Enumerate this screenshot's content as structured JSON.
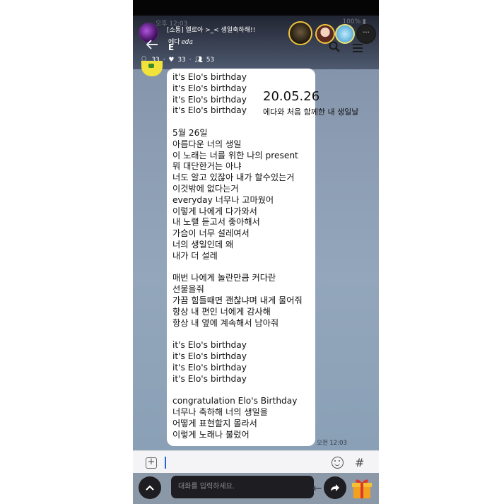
{
  "status_bar": {
    "time": "오후 12:03",
    "battery": "100% ▮"
  },
  "header": {
    "title": "[소통] 엘로아 >_< 생일축하해!!",
    "subtitle_ko": "에다",
    "subtitle_en": "eda",
    "e_letter": "E",
    "more_label": "···",
    "stats": {
      "members": "33",
      "likes": "33",
      "friends": "53"
    }
  },
  "message": {
    "lyrics": "it's Elo's birthday\nit's Elo's birthday\nit's Elo's birthday\nit's Elo's birthday\n\n5월 26일\n아름다운 너의 생일\n이 노래는 너를 위한 나의 present\n뭐 대단한거는 아냐\n너도 알고 있잖아 내가 할수있는거\n이것밖에 없다는거\neveryday 너무나 고마웠어\n이렇게 나에게 다가와서\n내 노랠 듣고서 좋아해서\n가슴이 너무 설레여서\n너의 생일인데 왜\n내가 더 설레\n\n매번 나에게 놀란만큼 커다란\n선물을줘\n가끔 힘들때면 괜찮냐며 내게 물어줘\n항상 내 편인 너에게 감사해\n항상 내 옆에 계속해서 남아줘\n\nit's Elo's birthday\nit's Elo's birthday\nit's Elo's birthday\nit's Elo's birthday\n\ncongratulation Elo's Birthday\n너무나 축하해 너의 생일을\n어떻게 표현할지 몰라서\n이렇게 노래나 불렀어",
    "time": "오전 12:03"
  },
  "caption": {
    "date": "20.05.26",
    "text": "에다와 처음 함께한 내 생일날"
  },
  "input": {
    "placeholder": "대화를 입력하세요."
  },
  "colors": {
    "chat_bg": "#8c9db3",
    "bubble": "#ffffff",
    "dark_button": "#1d1d22",
    "cursor": "#2b62d9"
  },
  "icons": [
    "back-arrow-icon",
    "search-icon",
    "menu-icon",
    "person-icon",
    "heart-icon",
    "people-icon",
    "plus-icon",
    "emoji-icon",
    "hash-icon",
    "chevron-up-icon",
    "share-icon",
    "gift-icon"
  ]
}
